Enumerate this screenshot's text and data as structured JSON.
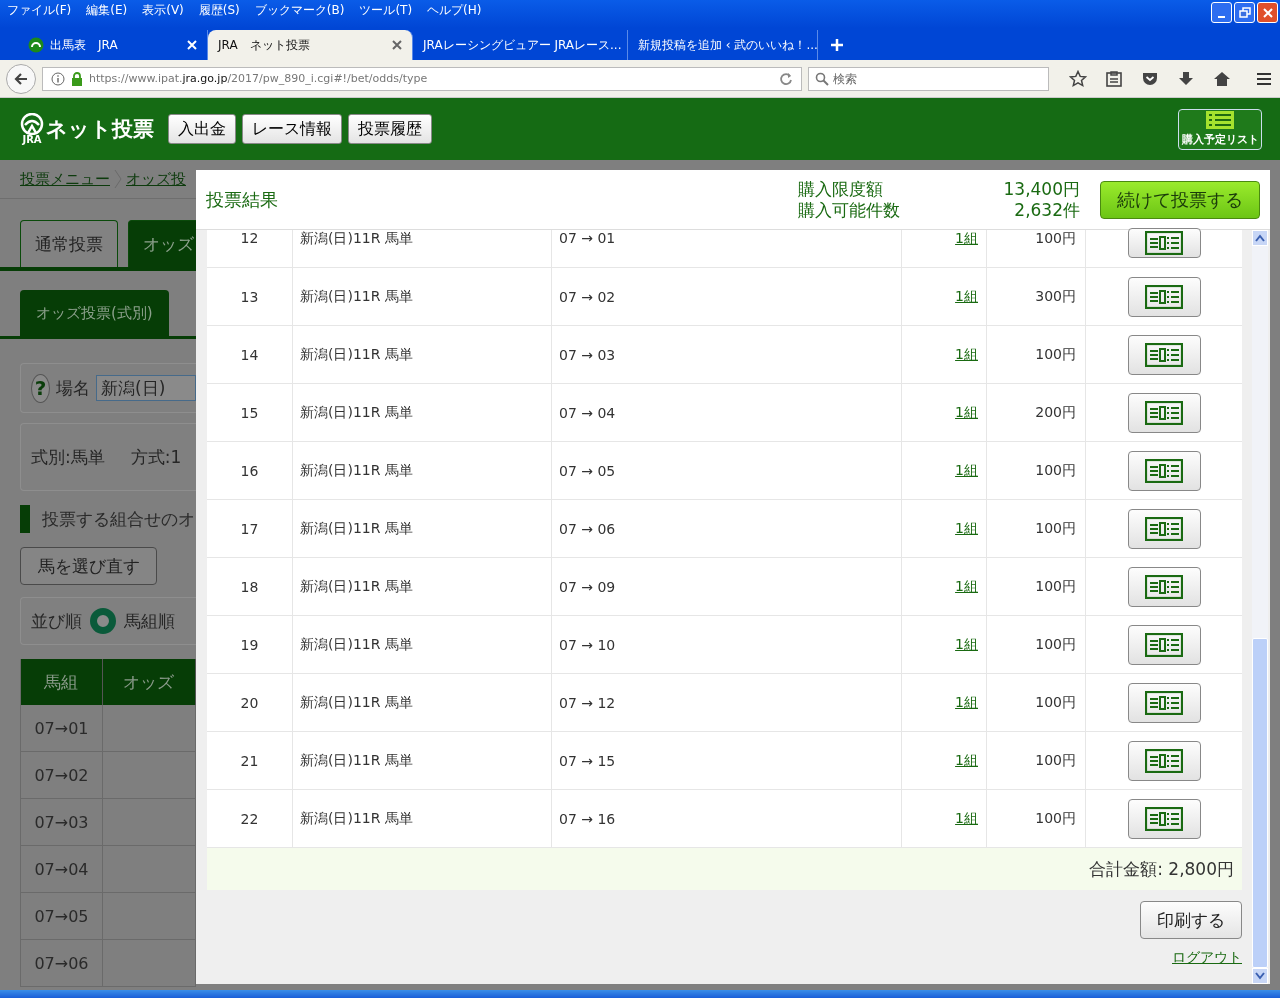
{
  "window": {
    "menu": [
      "ファイル(F)",
      "編集(E)",
      "表示(V)",
      "履歴(S)",
      "ブックマーク(B)",
      "ツール(T)",
      "ヘルプ(H)"
    ]
  },
  "browser_tabs": [
    {
      "label": "出馬表　JRA",
      "selected": false,
      "has_icon": true
    },
    {
      "label": "JRA　ネット投票",
      "selected": true,
      "has_icon": false
    },
    {
      "label": "JRAレーシングビュアー JRAレース...",
      "selected": false,
      "has_icon": false
    },
    {
      "label": "新規投稿を追加 ‹ 武のいいね！...",
      "selected": false,
      "has_icon": false
    }
  ],
  "address_bar": {
    "url": "https://www.ipat.**jra.go.jp**/2017/pw_890_i.cgi#!/bet/odds/type"
  },
  "search": {
    "placeholder": "検索"
  },
  "header": {
    "logo_mark": "JRA",
    "logo_text": "ネット投票",
    "nav_buttons": [
      "入出金",
      "レース情報",
      "投票履歴"
    ],
    "list_button": "購入予定リスト"
  },
  "background_page": {
    "breadcrumb": [
      "投票メニュー",
      "オッズ投"
    ],
    "tabs": [
      {
        "label": "通常投票",
        "selected": false
      },
      {
        "label": "オッズ",
        "selected": true
      }
    ],
    "subtabs": [
      {
        "label": "オッズ投票(式別)",
        "selected": true
      }
    ],
    "help_icon": "?",
    "venue": {
      "label": "場名",
      "value": "新潟(日)"
    },
    "bet_type": "式別:馬単",
    "method": "方式:1",
    "section_heading": "投票する組合せのオ",
    "reselect_button": "馬を選び直す",
    "sort": {
      "label": "並び順",
      "options": [
        {
          "label": "馬組順",
          "selected": true
        }
      ]
    },
    "odds_table": {
      "columns": [
        "馬組",
        "オッズ"
      ],
      "rows": [
        "07→01",
        "07→02",
        "07→03",
        "07→04",
        "07→05",
        "07→06"
      ]
    }
  },
  "modal": {
    "title": "投票結果",
    "limit_label": "購入限度額",
    "limit_value": "13,400円",
    "count_label": "購入可能件数",
    "count_value": "2,632件",
    "continue_button": "続けて投票する",
    "rows": [
      {
        "no": "12",
        "race": "新潟(日)11R 馬単",
        "combo": "07 → 01",
        "count": "1組",
        "amount": "100円"
      },
      {
        "no": "13",
        "race": "新潟(日)11R 馬単",
        "combo": "07 → 02",
        "count": "1組",
        "amount": "300円"
      },
      {
        "no": "14",
        "race": "新潟(日)11R 馬単",
        "combo": "07 → 03",
        "count": "1組",
        "amount": "100円"
      },
      {
        "no": "15",
        "race": "新潟(日)11R 馬単",
        "combo": "07 → 04",
        "count": "1組",
        "amount": "200円"
      },
      {
        "no": "16",
        "race": "新潟(日)11R 馬単",
        "combo": "07 → 05",
        "count": "1組",
        "amount": "100円"
      },
      {
        "no": "17",
        "race": "新潟(日)11R 馬単",
        "combo": "07 → 06",
        "count": "1組",
        "amount": "100円"
      },
      {
        "no": "18",
        "race": "新潟(日)11R 馬単",
        "combo": "07 → 09",
        "count": "1組",
        "amount": "100円"
      },
      {
        "no": "19",
        "race": "新潟(日)11R 馬単",
        "combo": "07 → 10",
        "count": "1組",
        "amount": "100円"
      },
      {
        "no": "20",
        "race": "新潟(日)11R 馬単",
        "combo": "07 → 12",
        "count": "1組",
        "amount": "100円"
      },
      {
        "no": "21",
        "race": "新潟(日)11R 馬単",
        "combo": "07 → 15",
        "count": "1組",
        "amount": "100円"
      },
      {
        "no": "22",
        "race": "新潟(日)11R 馬単",
        "combo": "07 → 16",
        "count": "1組",
        "amount": "100円"
      }
    ],
    "total": "合計金額: 2,800円",
    "print_button": "印刷する",
    "logout": "ログアウト"
  }
}
